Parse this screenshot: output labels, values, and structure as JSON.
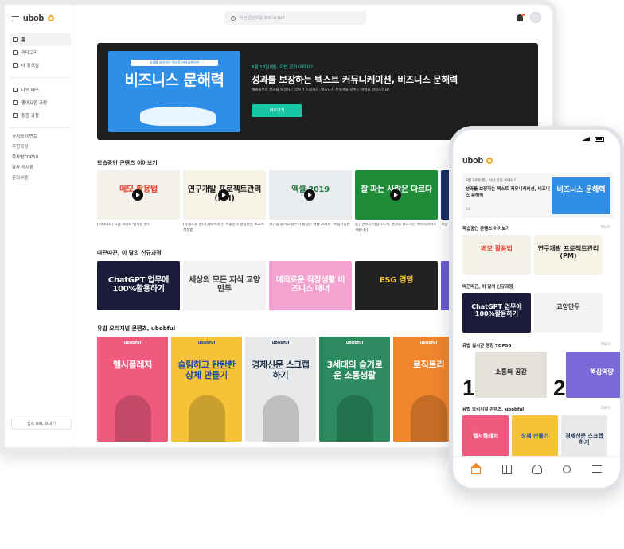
{
  "brand": {
    "logo": "ubob"
  },
  "sidebar": {
    "items": [
      {
        "label": "홈",
        "icon": "home-icon",
        "active": true
      },
      {
        "label": "카테고리",
        "icon": "grid-icon"
      },
      {
        "label": "내 강의실",
        "icon": "video-icon"
      }
    ],
    "items2": [
      {
        "label": "나의 메모",
        "icon": "note-icon"
      },
      {
        "label": "좋아요한 과정",
        "icon": "heart-icon"
      },
      {
        "label": "찜한 과정",
        "icon": "bookmark-icon"
      }
    ],
    "links": [
      "공지와 이벤트",
      "추천과정",
      "화사별TOP50",
      "화사 게시판",
      "문의사항"
    ],
    "bottom_button": "접속 URL 보내기"
  },
  "topbar": {
    "search_placeholder": "어떤 콘텐츠를 찾으시나요?"
  },
  "hero": {
    "art_tag": "성과를 보장하는 텍스트 커뮤니케이션",
    "art_title": "비즈니스 문해력",
    "sub": "8월 18일(월), 이번 강의 어때요?",
    "title": "성과를 보장하는 텍스트 커뮤니케이션, 비즈니스 문해력",
    "desc": "채새솔부터 성과를 보장하는 글쓰기 스킬까지, 비즈니스 문해력을 갖추는 비법을 알려드려요!",
    "button": "바로가기"
  },
  "sections": {
    "continue": "학습중인 콘텐츠 이어보기",
    "new": "따끈따끈, 이 달의 신규과정",
    "original": "유밥 오리지널 콘텐츠, ubobful"
  },
  "continue_items": [
    {
      "thumb": "메모 활용법",
      "caption": "[리더대화] 요즘 리더의 일하는 방식",
      "bg": "#f4f1ea",
      "fg": "#e8402e"
    },
    {
      "thumb": "연구개발 프로젝트관리(PM)",
      "caption": "[유쾌즈를 만나다]보서의 신 핵심원의 정립한는 보고서 작성법",
      "bg": "#f7f3e6",
      "fg": "#222222"
    },
    {
      "thumb": "엑셀 2019",
      "caption": "시간을 줄이고 업무가 즐겁는 엑셀 2019 - 핵심기능편",
      "bg": "#e9ecef",
      "fg": "#1f7a3d"
    },
    {
      "thumb": "잘 파는 사람은 다르다",
      "caption": "중간관리자 막탐하소서, 성과를 리드하는 매이칙보아로 거듭나다",
      "bg": "#1f8c3a",
      "fg": "#ffffff"
    },
    {
      "thumb": "",
      "caption": "세상",
      "bg": "#1a2f6b",
      "fg": "#ffffff"
    }
  ],
  "new_items": [
    {
      "thumb": "ChatGPT 업무에 100%활용하기",
      "bg": "#1b1b3a",
      "fg": "#ffffff"
    },
    {
      "thumb": "세상의 모든 지식 교양만두",
      "bg": "#f1f3f5",
      "fg": "#333333"
    },
    {
      "thumb": "예의로운 직장생활 비즈니스 매너",
      "bg": "#f2a3d0",
      "fg": "#ffffff"
    },
    {
      "thumb": "ESG 경영",
      "bg": "#222222",
      "fg": "#f2c230"
    },
    {
      "thumb": "",
      "bg": "#6b5bd6",
      "fg": "#ffffff"
    }
  ],
  "original_items": [
    {
      "tag": "ubobful",
      "title": "헬시플레저",
      "bg": "#f05a7e",
      "fg": "#ffffff"
    },
    {
      "tag": "ubobful",
      "title": "슬림하고 탄탄한 상체 만들기",
      "bg": "#f6c238",
      "fg": "#1a4aa8"
    },
    {
      "tag": "ubobful",
      "title": "경제신문 스크랩하기",
      "bg": "#e8e9eb",
      "fg": "#1a2f4a"
    },
    {
      "tag": "ubobful",
      "title": "3세대의 슬기로운 소통생활",
      "bg": "#2d8a5f",
      "fg": "#ffffff"
    },
    {
      "tag": "ubobful",
      "title": "로직트리",
      "bg": "#f0852d",
      "fg": "#ffffff"
    }
  ],
  "phone": {
    "time": "",
    "banner_sub": "8월 18일(월), 이런 강의 어때요?",
    "banner_title": "성과를 보장하는 텍스트 커뮤니케이션, 비즈니스 문해력",
    "banner_page": "1/4",
    "banner_art": "비즈니스 문해력",
    "sections": {
      "continue": "학습중인 콘텐츠 이어보기",
      "new": "따끈따끈, 이 달의 신규과정",
      "rank": "유밥 실시간 랭킹 TOP50",
      "original": "유밥 오리지널 콘텐츠, ubobful"
    },
    "more": "더보기",
    "continue_items": [
      {
        "thumb": "메모 활용법",
        "bg": "#f4f1ea",
        "fg": "#e8402e"
      },
      {
        "thumb": "연구개발 프로젝트관리(PM)",
        "bg": "#f7f3e6",
        "fg": "#222222"
      }
    ],
    "new_items": [
      {
        "thumb": "ChatGPT 업무에 100%활용하기",
        "bg": "#1b1b3a",
        "fg": "#ffffff"
      },
      {
        "thumb": "교양만두",
        "bg": "#f1f3f5",
        "fg": "#333333"
      }
    ],
    "rank_items": [
      {
        "rank": "1",
        "thumb": "소통의 공감",
        "bg": "#e4e1da",
        "fg": "#222222"
      },
      {
        "rank": "2",
        "thumb": "핵심역량",
        "bg": "#7a6ad8",
        "fg": "#ffffff"
      }
    ],
    "original_items": [
      {
        "thumb": "헬시플레저",
        "bg": "#f05a7e",
        "fg": "#ffffff"
      },
      {
        "thumb": "상체 만들기",
        "bg": "#f6c238",
        "fg": "#1a4aa8"
      },
      {
        "thumb": "경제신문 스크랩하기",
        "bg": "#e8e9eb",
        "fg": "#1a2f4a"
      }
    ]
  }
}
